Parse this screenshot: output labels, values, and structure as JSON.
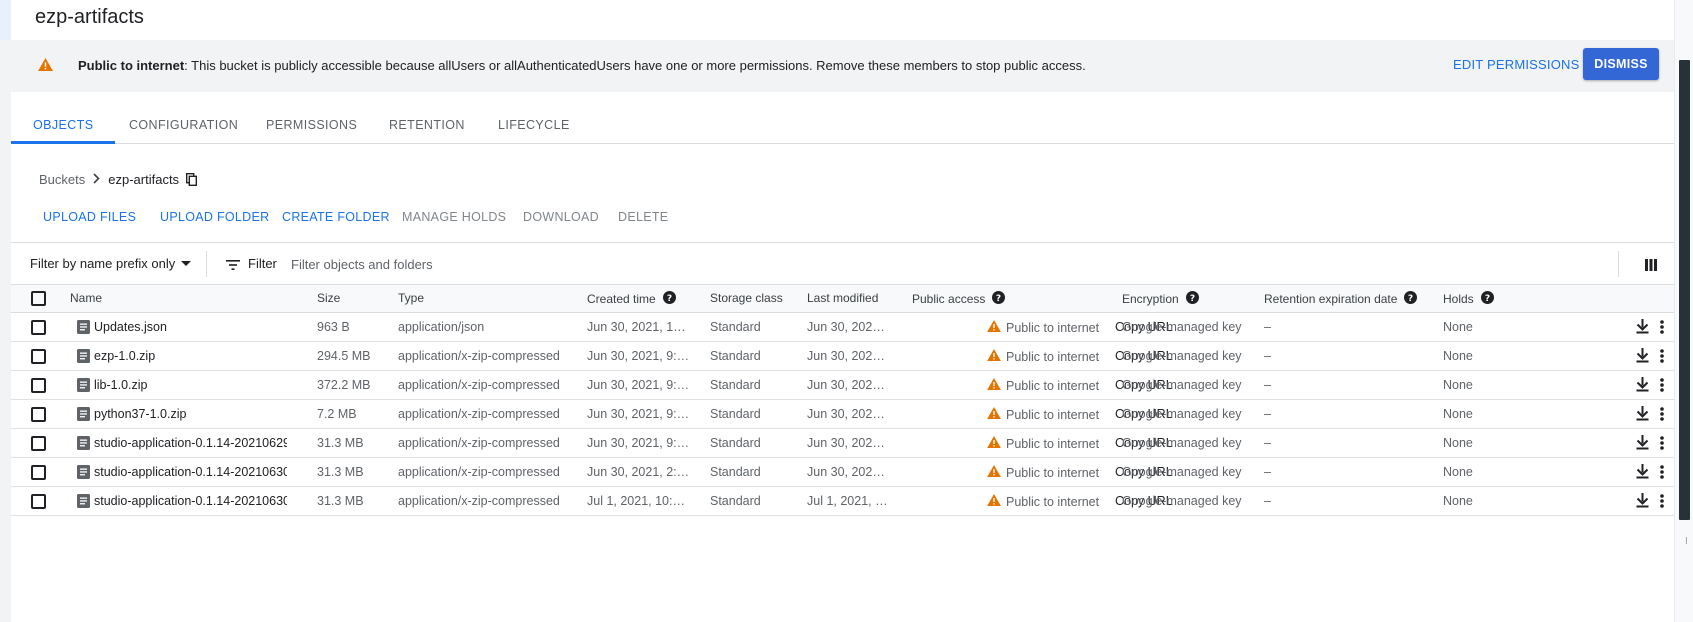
{
  "bucket_title": "ezp-artifacts",
  "banner": {
    "icon": "warning-icon",
    "bold": "Public to internet",
    "text": ": This bucket is publicly accessible because allUsers or allAuthenticatedUsers have one or more permissions. Remove these members to stop public access.",
    "edit_label": "EDIT PERMISSIONS",
    "dismiss_label": "DISMISS"
  },
  "tabs": [
    "OBJECTS",
    "CONFIGURATION",
    "PERMISSIONS",
    "RETENTION",
    "LIFECYCLE"
  ],
  "active_tab": "OBJECTS",
  "breadcrumb": {
    "root": "Buckets",
    "current": "ezp-artifacts"
  },
  "actions": {
    "upload_files": "UPLOAD FILES",
    "upload_folder": "UPLOAD FOLDER",
    "create_folder": "CREATE FOLDER",
    "manage_holds": "MANAGE HOLDS",
    "download": "DOWNLOAD",
    "delete": "DELETE"
  },
  "filter": {
    "prefix_label": "Filter by name prefix only",
    "label": "Filter",
    "placeholder": "Filter objects and folders"
  },
  "columns": {
    "name": "Name",
    "size": "Size",
    "type": "Type",
    "created": "Created time",
    "storage": "Storage class",
    "modified": "Last modified",
    "public": "Public access",
    "encryption": "Encryption",
    "retention": "Retention expiration date",
    "holds": "Holds"
  },
  "rows": [
    {
      "name": "Updates.json",
      "size": "963 B",
      "type": "application/json",
      "created": "Jun 30, 2021, 1…",
      "storage": "Standard",
      "modified": "Jun 30, 202…",
      "public": "Public to internet",
      "copy": "Copy URL",
      "encryption": "Google-managed key",
      "retention": "–",
      "holds": "None"
    },
    {
      "name": "ezp-1.0.zip",
      "size": "294.5 MB",
      "type": "application/x-zip-compressed",
      "created": "Jun 30, 2021, 9:…",
      "storage": "Standard",
      "modified": "Jun 30, 202…",
      "public": "Public to internet",
      "copy": "Copy URL",
      "encryption": "Google-managed key",
      "retention": "–",
      "holds": "None"
    },
    {
      "name": "lib-1.0.zip",
      "size": "372.2 MB",
      "type": "application/x-zip-compressed",
      "created": "Jun 30, 2021, 9:…",
      "storage": "Standard",
      "modified": "Jun 30, 202…",
      "public": "Public to internet",
      "copy": "Copy URL",
      "encryption": "Google-managed key",
      "retention": "–",
      "holds": "None"
    },
    {
      "name": "python37-1.0.zip",
      "size": "7.2 MB",
      "type": "application/x-zip-compressed",
      "created": "Jun 30, 2021, 9:…",
      "storage": "Standard",
      "modified": "Jun 30, 202…",
      "public": "Public to internet",
      "copy": "Copy URL",
      "encryption": "Google-managed key",
      "retention": "–",
      "holds": "None"
    },
    {
      "name": "studio-application-0.1.14-20210629.",
      "size": "31.3 MB",
      "type": "application/x-zip-compressed",
      "created": "Jun 30, 2021, 9:…",
      "storage": "Standard",
      "modified": "Jun 30, 202…",
      "public": "Public to internet",
      "copy": "Copy URL",
      "encryption": "Google-managed key",
      "retention": "–",
      "holds": "None"
    },
    {
      "name": "studio-application-0.1.14-20210630.",
      "size": "31.3 MB",
      "type": "application/x-zip-compressed",
      "created": "Jun 30, 2021, 2:…",
      "storage": "Standard",
      "modified": "Jun 30, 202…",
      "public": "Public to internet",
      "copy": "Copy URL",
      "encryption": "Google-managed key",
      "retention": "–",
      "holds": "None"
    },
    {
      "name": "studio-application-0.1.14-20210630.",
      "size": "31.3 MB",
      "type": "application/x-zip-compressed",
      "created": "Jul 1, 2021, 10:…",
      "storage": "Standard",
      "modified": "Jul 1, 2021, …",
      "public": "Public to internet",
      "copy": "Copy URL",
      "encryption": "Google-managed key",
      "retention": "–",
      "holds": "None"
    }
  ],
  "colors": {
    "accent": "#1a73e8",
    "dismiss": "#3367d6",
    "warning": "#e37400"
  }
}
